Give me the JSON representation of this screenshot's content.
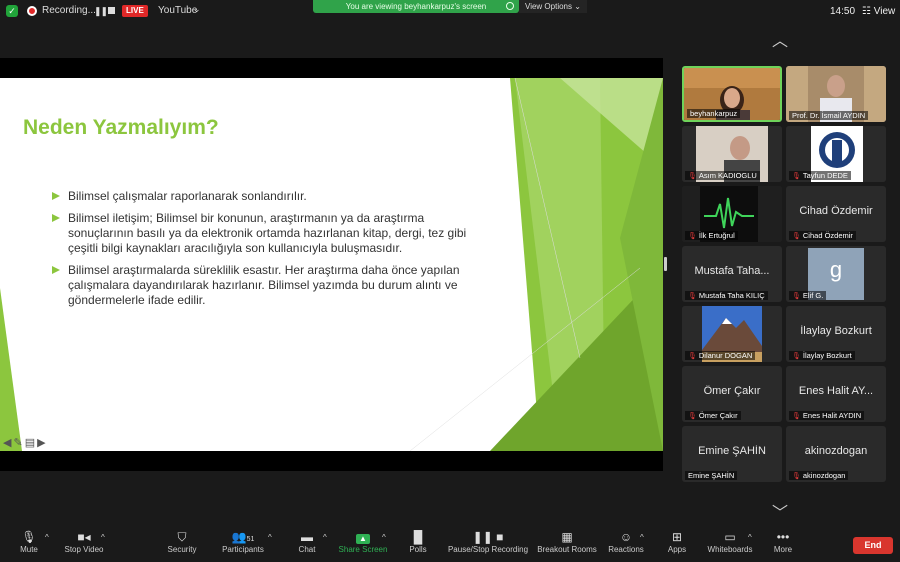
{
  "topbar": {
    "recording_label": "Recording...",
    "live_badge": "LIVE",
    "stream_target": "YouTube",
    "viewing_banner": "You are viewing beyhankarpuz's screen",
    "view_options": "View Options",
    "clock": "14:50",
    "view_label": "View"
  },
  "slide": {
    "title": "Neden Yazmalıyım?",
    "bullets": [
      "Bilimsel çalışmalar raporlanarak sonlandırılır.",
      "Bilimsel iletişim; Bilimsel bir konunun, araştırmanın ya da araştırma sonuçlarının basılı ya da elektronik ortamda hazırlanan kitap, dergi, tez gibi çeşitli bilgi kaynakları aracılığıyla son kullanıcıyla buluşmasıdır.",
      "Bilimsel araştırmalarda süreklilik esastır. Her araştırma daha önce yapılan çalışmalara dayandırılarak hazırlanır. Bilimsel yazımda bu durum alıntı ve göndermelerle ifade edilir."
    ],
    "accent_color": "#8cc63e"
  },
  "participants": [
    {
      "name": "beyhankarpuz",
      "big": "",
      "type": "video"
    },
    {
      "name": "Prof. Dr. İsmail AYDIN",
      "big": "",
      "type": "video"
    },
    {
      "name": "Asım KADIOGLU",
      "big": "",
      "type": "video"
    },
    {
      "name": "Tayfun DEDE",
      "big": "",
      "type": "logo"
    },
    {
      "name": "İlk Ertuğrul",
      "big": "",
      "type": "pulse"
    },
    {
      "name": "Cihad Özdemir",
      "big": "Cihad Özdemir",
      "type": "name"
    },
    {
      "name": "Mustafa Taha KILIÇ",
      "big": "Mustafa Taha...",
      "type": "name"
    },
    {
      "name": "Elif G.",
      "big": "g",
      "type": "letter"
    },
    {
      "name": "Dilanur DOGAN",
      "big": "",
      "type": "mountain"
    },
    {
      "name": "İlaylay Bozkurt",
      "big": "İlaylay Bozkurt",
      "type": "name"
    },
    {
      "name": "Ömer Çakır",
      "big": "Ömer Çakır",
      "type": "name"
    },
    {
      "name": "Enes Halit AYDIN",
      "big": "Enes Halit AY...",
      "type": "name"
    },
    {
      "name": "Emine ŞAHİN",
      "big": "Emine ŞAHİN",
      "type": "name"
    },
    {
      "name": "akinozdogan",
      "big": "akinozdogan",
      "type": "name"
    }
  ],
  "toolbar": {
    "mute": "Mute",
    "stop_video": "Stop Video",
    "security": "Security",
    "participants": "Participants",
    "participant_count": "51",
    "chat": "Chat",
    "share_screen": "Share Screen",
    "polls": "Polls",
    "pause_recording": "Pause/Stop Recording",
    "breakout": "Breakout Rooms",
    "reactions": "Reactions",
    "apps": "Apps",
    "whiteboards": "Whiteboards",
    "more": "More",
    "end": "End"
  }
}
